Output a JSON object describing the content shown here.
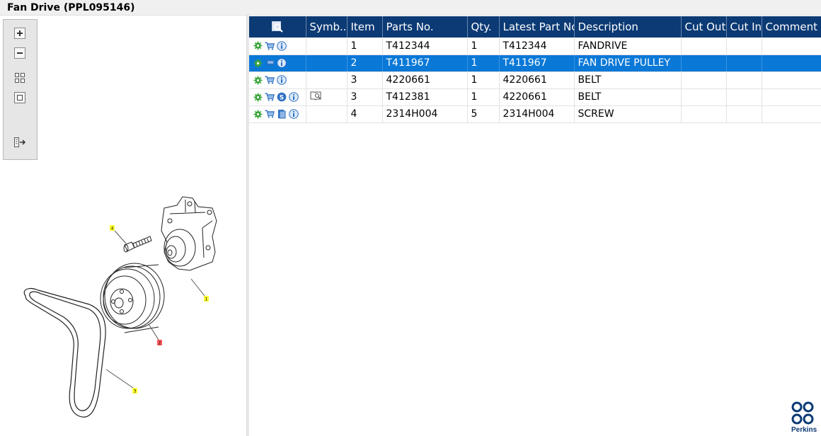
{
  "window": {
    "title": "Fan Drive (PPL095146)"
  },
  "toolbox": {
    "zoom_in_icon": "zoom-in-icon",
    "zoom_out_icon": "zoom-out-icon",
    "fit_all_icon": "fit-all-icon",
    "fit_window_icon": "fit-window-icon",
    "export_icon": "export-icon"
  },
  "diagram": {
    "callouts": [
      {
        "label": "4",
        "color": "#ffff33"
      },
      {
        "label": "1",
        "color": "#ffff33"
      },
      {
        "label": "2",
        "color": "#ff5a5a"
      },
      {
        "label": "3",
        "color": "#ffff33"
      }
    ]
  },
  "table": {
    "columns": [
      "",
      "Symb...",
      "Item",
      "Parts No.",
      "Qty.",
      "Latest Part No.",
      "Description",
      "Cut Out",
      "Cut In",
      "Comment"
    ],
    "rows": [
      {
        "icons": [
          "gear",
          "cart",
          "info"
        ],
        "symbol": "",
        "item": "1",
        "part_no": "T412344",
        "qty": "1",
        "latest_part_no": "T412344",
        "description": "FANDRIVE",
        "cut_out": "",
        "cut_in": "",
        "comment": ""
      },
      {
        "icons": [
          "gear",
          "cart",
          "info"
        ],
        "symbol": "",
        "item": "2",
        "part_no": "T411967",
        "qty": "1",
        "latest_part_no": "T411967",
        "description": "FAN DRIVE PULLEY",
        "cut_out": "",
        "cut_in": "",
        "comment": "",
        "selected": true
      },
      {
        "icons": [
          "gear",
          "cart",
          "info"
        ],
        "symbol": "",
        "item": "3",
        "part_no": "4220661",
        "qty": "1",
        "latest_part_no": "4220661",
        "description": "BELT",
        "cut_out": "",
        "cut_in": "",
        "comment": ""
      },
      {
        "icons": [
          "gear",
          "cart",
          "service",
          "info"
        ],
        "symbol": "book-search",
        "item": "3",
        "part_no": "T412381",
        "qty": "1",
        "latest_part_no": "4220661",
        "description": "BELT",
        "cut_out": "",
        "cut_in": "",
        "comment": ""
      },
      {
        "icons": [
          "gear",
          "cart",
          "document",
          "info"
        ],
        "symbol": "",
        "item": "4",
        "part_no": "2314H004",
        "qty": "5",
        "latest_part_no": "2314H004",
        "description": "SCREW",
        "cut_out": "",
        "cut_in": "",
        "comment": ""
      }
    ]
  },
  "brand": {
    "name": "Perkins"
  },
  "colors": {
    "header": "#0b3a74",
    "selected_row": "#0a78d7",
    "gear": "#3aa53a",
    "cart": "#2b6fc2",
    "info": "#2b6fc2"
  }
}
